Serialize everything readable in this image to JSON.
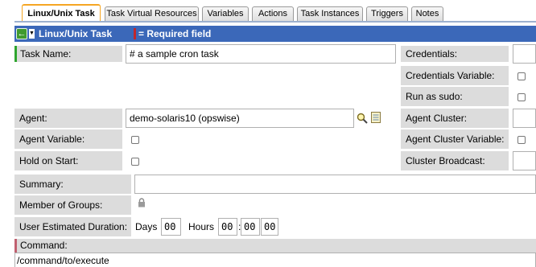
{
  "tabs": [
    {
      "label": "Linux/Unix Task",
      "active": true
    },
    {
      "label": "Task Virtual Resources",
      "active": false
    },
    {
      "label": "Variables",
      "active": false
    },
    {
      "label": "Actions",
      "active": false
    },
    {
      "label": "Task Instances",
      "active": false
    },
    {
      "label": "Triggers",
      "active": false
    },
    {
      "label": "Notes",
      "active": false
    }
  ],
  "titlebar": {
    "title": "Linux/Unix Task",
    "required_legend": "= Required field"
  },
  "form": {
    "task_name_label": "Task Name:",
    "task_name_value": "# a sample cron task",
    "credentials_label": "Credentials:",
    "credentials_variable_label": "Credentials Variable:",
    "run_as_sudo_label": "Run as sudo:",
    "agent_label": "Agent:",
    "agent_value": "demo-solaris10 (opswise)",
    "agent_cluster_label": "Agent Cluster:",
    "agent_variable_label": "Agent Variable:",
    "agent_cluster_variable_label": "Agent Cluster Variable:",
    "hold_on_start_label": "Hold on Start:",
    "cluster_broadcast_label": "Cluster Broadcast:",
    "summary_label": "Summary:",
    "member_of_groups_label": "Member of Groups:",
    "duration_label": "User Estimated Duration:",
    "days_label": "Days",
    "days_value": "00",
    "hours_label": "Hours",
    "hours_value": "00",
    "minutes_value": "00",
    "seconds_value": "00",
    "colon": ":",
    "command_label": "Command:",
    "command_value": "/command/to/execute"
  },
  "colors": {
    "accent": "#3b68b9",
    "active_tab_border": "#f5a623",
    "required_marker": "#c0272d",
    "label_bg": "#dcdcdc"
  },
  "icons": {
    "back": "green-back-arrow-icon",
    "menu": "dropdown-menu-icon",
    "lookup": "magnifier-icon",
    "details": "document-icon",
    "lock": "lock-icon"
  }
}
